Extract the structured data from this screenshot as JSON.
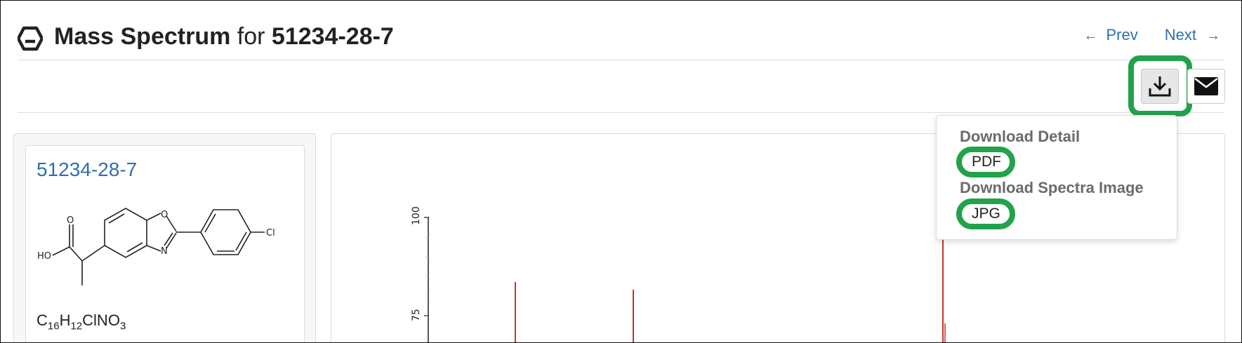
{
  "header": {
    "title_prefix": "Mass Spectrum",
    "title_for": "for",
    "title_cas": "51234-28-7",
    "prev_label": "Prev",
    "next_label": "Next"
  },
  "icons": {
    "logo": "hexagon-logo-icon",
    "download": "download-icon",
    "email": "envelope-icon",
    "prev": "arrow-left-icon",
    "next": "arrow-right-icon"
  },
  "compound": {
    "cas_link": "51234-28-7",
    "formula": {
      "parts": [
        {
          "el": "C",
          "n": "16"
        },
        {
          "el": "H",
          "n": "12"
        },
        {
          "el": "ClNO",
          "n": "3"
        }
      ]
    },
    "structure_labels": {
      "o_carbonyl": "O",
      "ho": "HO",
      "o_ring": "O",
      "n_ring": "N",
      "cl": "Cl"
    }
  },
  "spectrum": {
    "y_ticks": [
      "100",
      "75"
    ],
    "peak_color": "#c0392b"
  },
  "download_menu": {
    "section1_title": "Download Detail",
    "section1_item": "PDF",
    "section2_title": "Download Spectra Image",
    "section2_item": "JPG"
  },
  "colors": {
    "link": "#2f6fb0",
    "highlight": "#22a24a",
    "peak": "#c0392b"
  }
}
